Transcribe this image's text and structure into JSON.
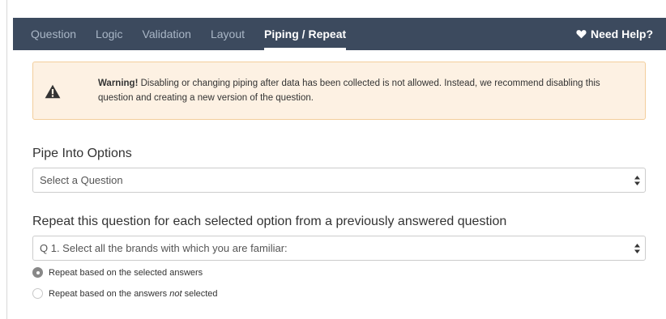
{
  "tabs": [
    {
      "label": "Question",
      "active": false
    },
    {
      "label": "Logic",
      "active": false
    },
    {
      "label": "Validation",
      "active": false
    },
    {
      "label": "Layout",
      "active": false
    },
    {
      "label": "Piping / Repeat",
      "active": true
    }
  ],
  "help": {
    "label": "Need Help?",
    "icon": "heart-icon"
  },
  "warning": {
    "icon": "warning-triangle-icon",
    "title": "Warning!",
    "message": "Disabling or changing piping after data has been collected is not allowed. Instead, we recommend disabling this question and creating a new version of the question."
  },
  "pipe": {
    "label": "Pipe Into Options",
    "selected": "Select a Question"
  },
  "repeat": {
    "label": "Repeat this question for each selected option from a previously answered question",
    "selected": "Q 1. Select all the brands with which you are familiar:",
    "options": [
      {
        "prefix": "Repeat based on the selected answers",
        "emphasis": "",
        "suffix": "",
        "checked": true
      },
      {
        "prefix": "Repeat based on the answers ",
        "emphasis": "not",
        "suffix": " selected",
        "checked": false
      }
    ]
  },
  "colors": {
    "tabbar_bg": "#3c4a5e",
    "tab_inactive": "#a9b6c6",
    "warning_bg": "#fdf1e3",
    "warning_border": "#f3ce9c"
  }
}
